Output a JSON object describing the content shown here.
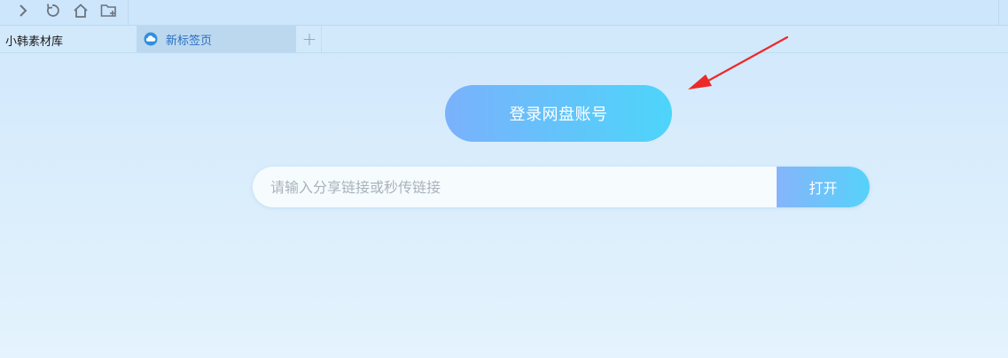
{
  "toolbar": {
    "buttons": [
      {
        "name": "forward",
        "icon": "chevron-right-icon"
      },
      {
        "name": "refresh",
        "icon": "refresh-icon"
      },
      {
        "name": "home",
        "icon": "home-icon"
      },
      {
        "name": "new-folder",
        "icon": "folder-add-icon"
      }
    ]
  },
  "sidebar": {
    "title": "小韩素材库"
  },
  "tabs": {
    "active_label": "新标签页",
    "active_icon": "cloud-icon",
    "add_label": "+"
  },
  "main": {
    "login_label": "登录网盘账号",
    "share_input_placeholder": "请输入分享链接或秒传链接",
    "share_input_value": "",
    "open_label": "打开"
  },
  "colors": {
    "accent_start": "#7ab1fb",
    "accent_end": "#4dd5fa",
    "annotation_arrow": "#ec2a2a",
    "tab_text": "#2b6fc0"
  }
}
